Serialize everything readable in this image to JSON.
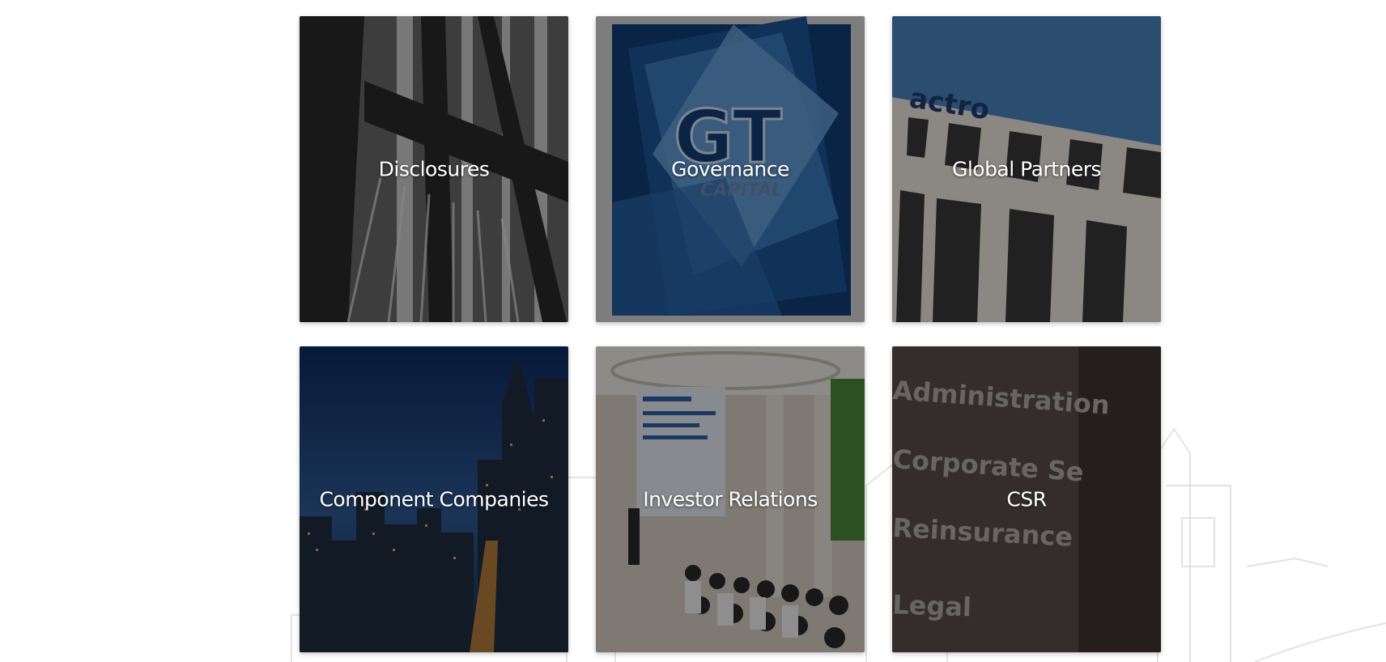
{
  "tiles": [
    {
      "label": "Disclosures"
    },
    {
      "label": "Governance",
      "logo_text": "GT",
      "logo_sub": "CAPITAL"
    },
    {
      "label": "Global Partners"
    },
    {
      "label": "Component Companies"
    },
    {
      "label": "Investor Relations"
    },
    {
      "label": "CSR",
      "sign_lines": [
        "Administration",
        "Corporate Se",
        "Reinsurance",
        "Legal"
      ]
    }
  ],
  "colors": {
    "overlay": "#000000",
    "label": "#ffffff",
    "governance_blue": "#1c4f86"
  }
}
